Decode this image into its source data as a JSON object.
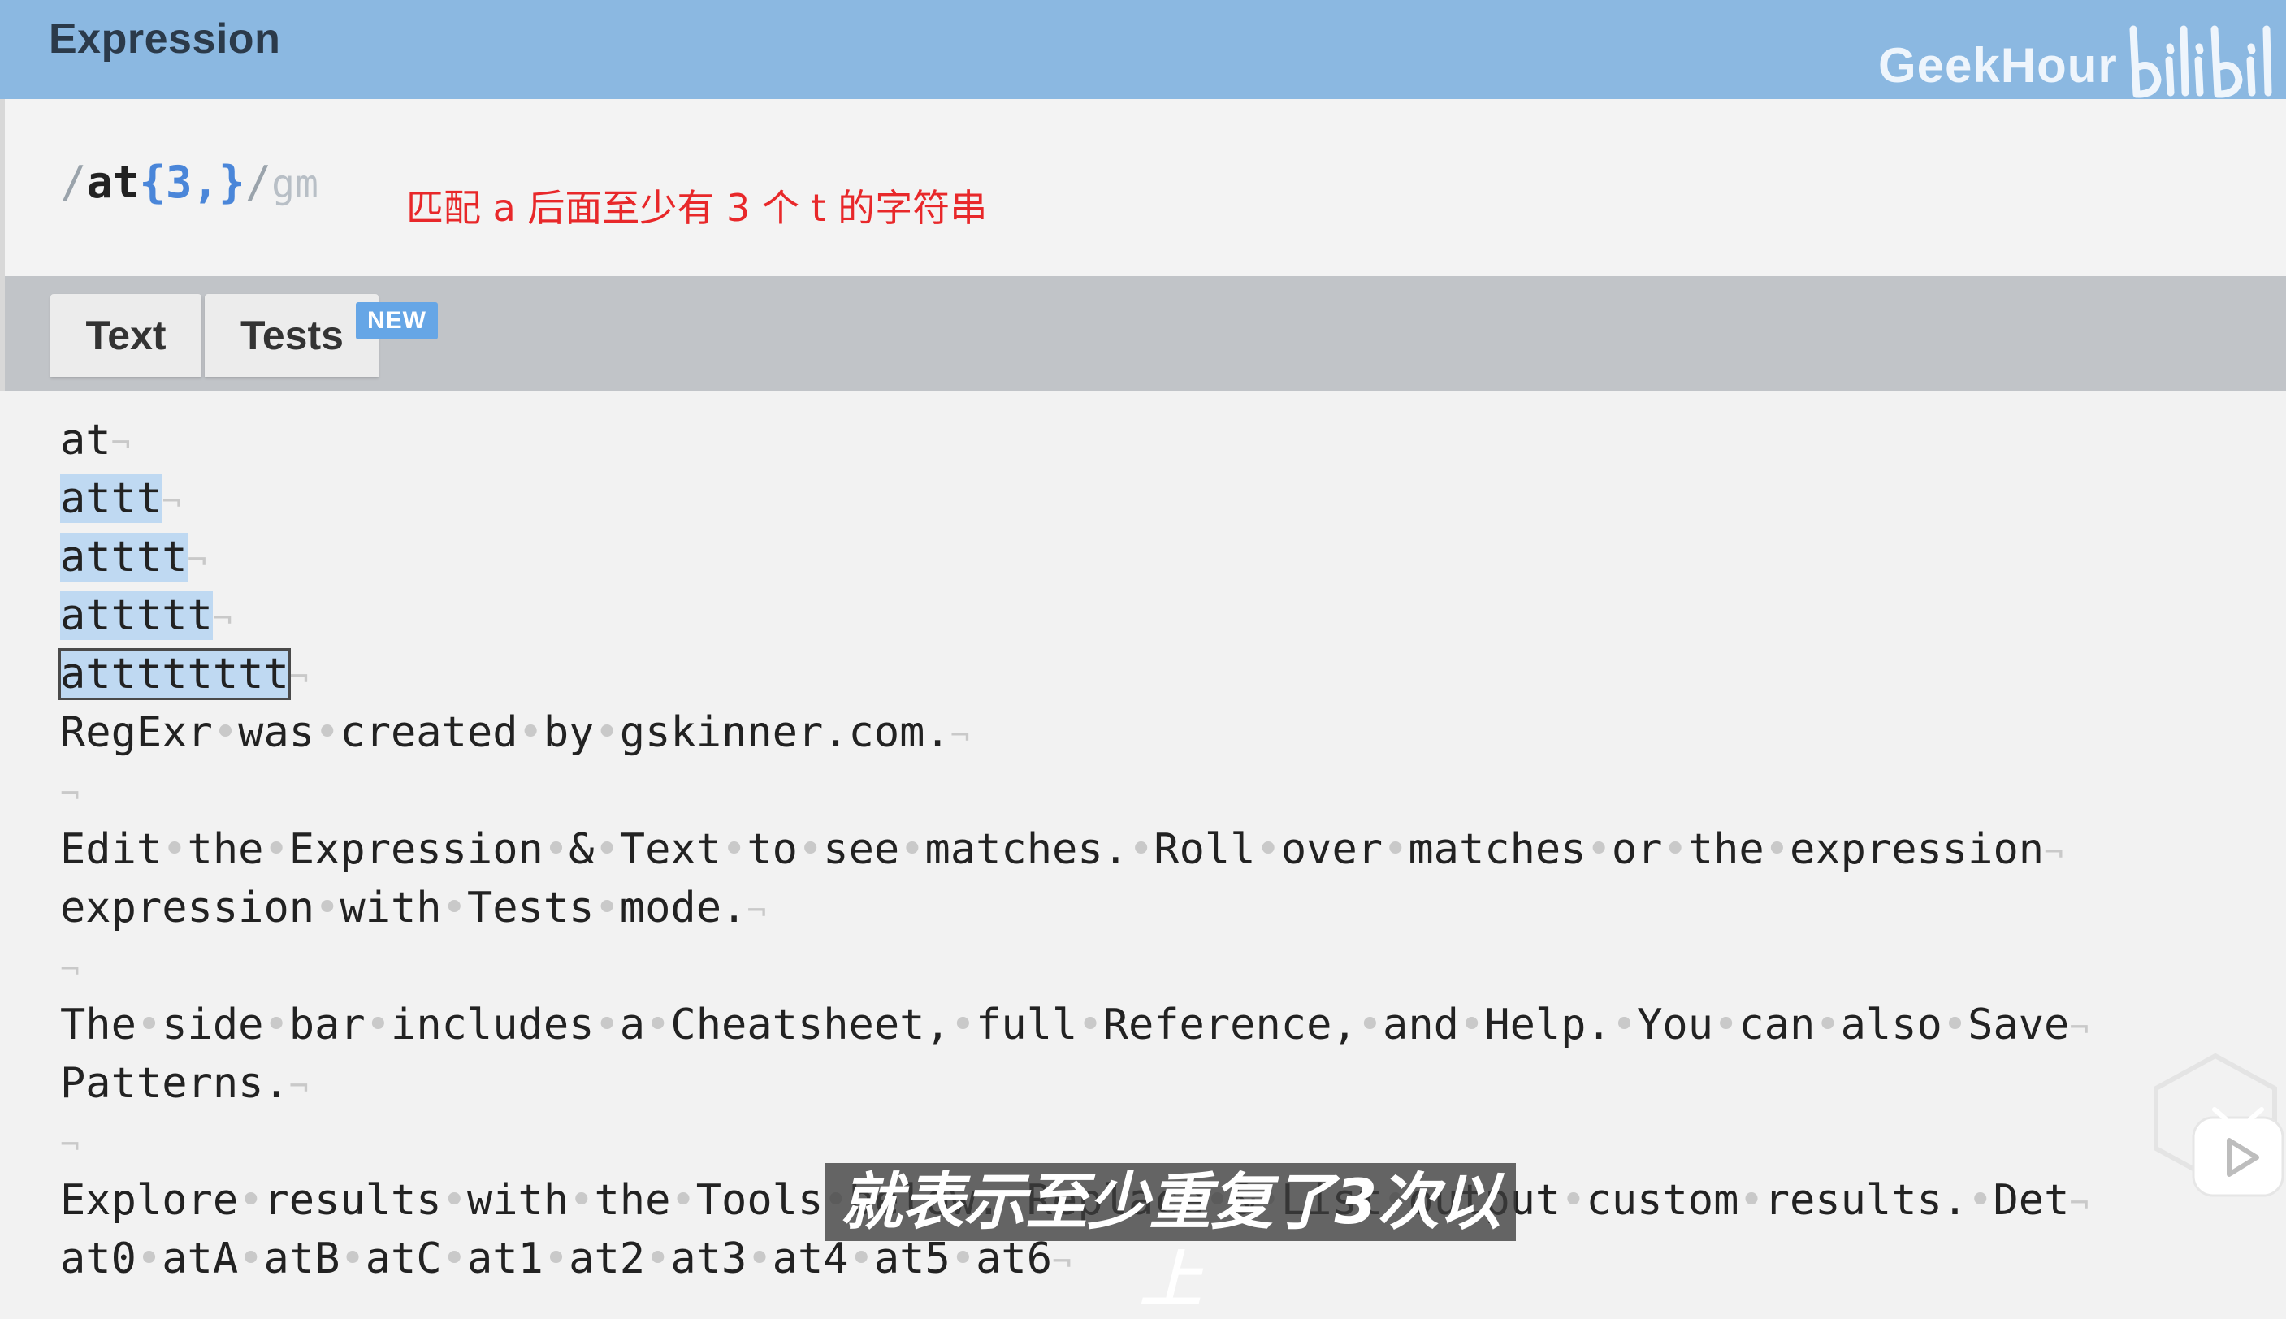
{
  "header": {
    "title": "Expression",
    "brand": "GeekHour",
    "logo_icon": "bilibili-logo-icon",
    "bg_color": "#8bb8e1"
  },
  "expression": {
    "open_slash": "/",
    "literal": "at",
    "quantifier": "{3,}",
    "close_slash": "/",
    "flags": "gm"
  },
  "annotation": "匹配 a 后面至少有 3 个 t 的字符串",
  "tabs": [
    {
      "label": "Text",
      "active": true
    },
    {
      "label": "Tests",
      "active": false
    }
  ],
  "badge_new": "NEW",
  "editor": {
    "eol_mark": "¬",
    "space_mark": "•",
    "lines": [
      {
        "text": "at",
        "match": "none"
      },
      {
        "text": "attt",
        "match": "match"
      },
      {
        "text": "atttt",
        "match": "match"
      },
      {
        "text": "attttt",
        "match": "match"
      },
      {
        "text": "atttttttt",
        "match": "selected"
      },
      {
        "text": "RegExr was created by gskinner.com.",
        "match": "none"
      },
      {
        "text": "",
        "match": "none"
      },
      {
        "text": "Edit the Expression & Text to see matches. Roll over matches or the expression",
        "match": "none"
      },
      {
        "text": "expression with Tests mode.",
        "match": "none"
      },
      {
        "text": "",
        "match": "none"
      },
      {
        "text": "The side bar includes a Cheatsheet, full Reference, and Help. You can also Save",
        "match": "none"
      },
      {
        "text": "Patterns.",
        "match": "none"
      },
      {
        "text": "",
        "match": "none"
      },
      {
        "text": "Explore results with the Tools below. Replace & List output custom results. Det",
        "match": "none"
      },
      {
        "text": "at0 atA atB atC at1 at2 at3 at4 at5 at6",
        "match": "none"
      }
    ],
    "highlight_color": "#bfd9f2"
  },
  "subtitle": "就表示至少重复了3次以上",
  "watermark_icon": "play-icon"
}
